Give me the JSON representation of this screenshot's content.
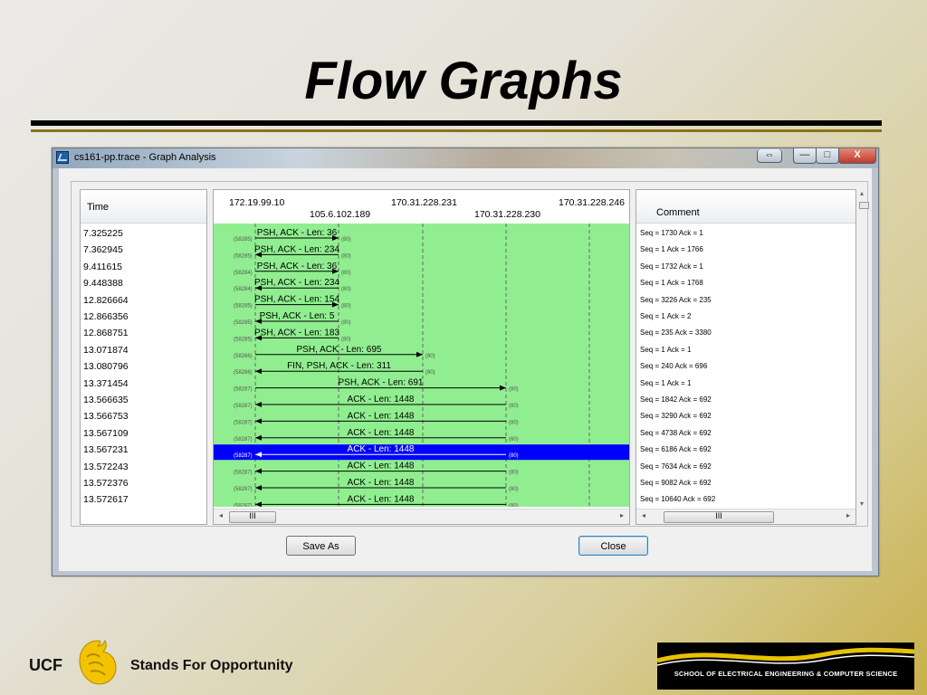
{
  "slide": {
    "title": "Flow Graphs",
    "footer_ucf": "UCF",
    "footer_motto": "Stands For Opportunity",
    "footer_school": "SCHOOL OF ELECTRICAL ENGINEERING & COMPUTER SCIENCE"
  },
  "window": {
    "title": "cs161-pp.trace - Graph Analysis",
    "restore_glyph": "⇔",
    "min_glyph": "—",
    "max_glyph": "□",
    "close_glyph": "X"
  },
  "time_panel": {
    "header": "Time",
    "rows": [
      "7.325225",
      "7.362945",
      "9.411615",
      "9.448388",
      "12.826664",
      "12.866356",
      "12.868751",
      "13.071874",
      "13.080796",
      "13.371454",
      "13.566635",
      "13.566753",
      "13.567109",
      "13.567231",
      "13.572243",
      "13.572376",
      "13.572617"
    ]
  },
  "graph": {
    "nodes": [
      "172.19.99.10",
      "105.6.102.189",
      "170.31.228.231",
      "170.31.228.230",
      "170.31.228.246"
    ],
    "flows": [
      {
        "label": "PSH, ACK - Len: 36",
        "from": 0,
        "to": 1,
        "src_port": "(58285)",
        "dst_port": "(80)"
      },
      {
        "label": "PSH, ACK - Len: 234",
        "from": 1,
        "to": 0,
        "src_port": "(58285)",
        "dst_port": "(80)"
      },
      {
        "label": "PSH, ACK - Len: 36",
        "from": 0,
        "to": 1,
        "src_port": "(58284)",
        "dst_port": "(80)"
      },
      {
        "label": "PSH, ACK - Len: 234",
        "from": 1,
        "to": 0,
        "src_port": "(58284)",
        "dst_port": "(80)"
      },
      {
        "label": "PSH, ACK - Len: 154",
        "from": 0,
        "to": 1,
        "src_port": "(58285)",
        "dst_port": "(80)"
      },
      {
        "label": "PSH, ACK - Len: 5",
        "from": 1,
        "to": 0,
        "src_port": "(58285)",
        "dst_port": "(80)"
      },
      {
        "label": "PSH, ACK - Len: 183",
        "from": 1,
        "to": 0,
        "src_port": "(58285)",
        "dst_port": "(80)"
      },
      {
        "label": "PSH, ACK - Len: 695",
        "from": 0,
        "to": 2,
        "src_port": "(58286)",
        "dst_port": "(80)"
      },
      {
        "label": "FIN, PSH, ACK - Len: 311",
        "from": 2,
        "to": 0,
        "src_port": "(58286)",
        "dst_port": "(80)"
      },
      {
        "label": "PSH, ACK - Len: 691",
        "from": 0,
        "to": 3,
        "src_port": "(58287)",
        "dst_port": "(80)"
      },
      {
        "label": "ACK - Len: 1448",
        "from": 3,
        "to": 0,
        "src_port": "(58287)",
        "dst_port": "(80)"
      },
      {
        "label": "ACK - Len: 1448",
        "from": 3,
        "to": 0,
        "src_port": "(58287)",
        "dst_port": "(80)"
      },
      {
        "label": "ACK - Len: 1448",
        "from": 3,
        "to": 0,
        "src_port": "(58287)",
        "dst_port": "(80)"
      },
      {
        "label": "ACK - Len: 1448",
        "from": 3,
        "to": 0,
        "src_port": "(58287)",
        "dst_port": "(80)",
        "selected": true
      },
      {
        "label": "ACK - Len: 1448",
        "from": 3,
        "to": 0,
        "src_port": "(58287)",
        "dst_port": "(80)"
      },
      {
        "label": "ACK - Len: 1448",
        "from": 3,
        "to": 0,
        "src_port": "(58287)",
        "dst_port": "(80)"
      },
      {
        "label": "ACK - Len: 1448",
        "from": 3,
        "to": 0,
        "src_port": "(58287)",
        "dst_port": "(80)"
      }
    ],
    "bg_color": "#90ee90",
    "selected_color": "#0000ff"
  },
  "comment_panel": {
    "header": "Comment",
    "rows": [
      "Seq = 1730 Ack = 1",
      "Seq = 1 Ack = 1766",
      "Seq = 1732 Ack = 1",
      "Seq = 1 Ack = 1768",
      "Seq = 3226 Ack = 235",
      "Seq = 1 Ack = 2",
      "Seq = 235 Ack = 3380",
      "Seq = 1 Ack = 1",
      "Seq = 240 Ack = 696",
      "Seq = 1 Ack = 1",
      "Seq = 1842 Ack = 692",
      "Seq = 3290 Ack = 692",
      "Seq = 4738 Ack = 692",
      "Seq = 6186 Ack = 692",
      "Seq = 7634 Ack = 692",
      "Seq = 9082 Ack = 692",
      "Seq = 10640 Ack = 692"
    ]
  },
  "scrollbar": {
    "thumb_glyph": "III",
    "left_arrow": "◂",
    "right_arrow": "▸",
    "up_arrow": "▴",
    "down_arrow": "▾"
  },
  "buttons": {
    "save_as": "Save As",
    "close": "Close"
  }
}
